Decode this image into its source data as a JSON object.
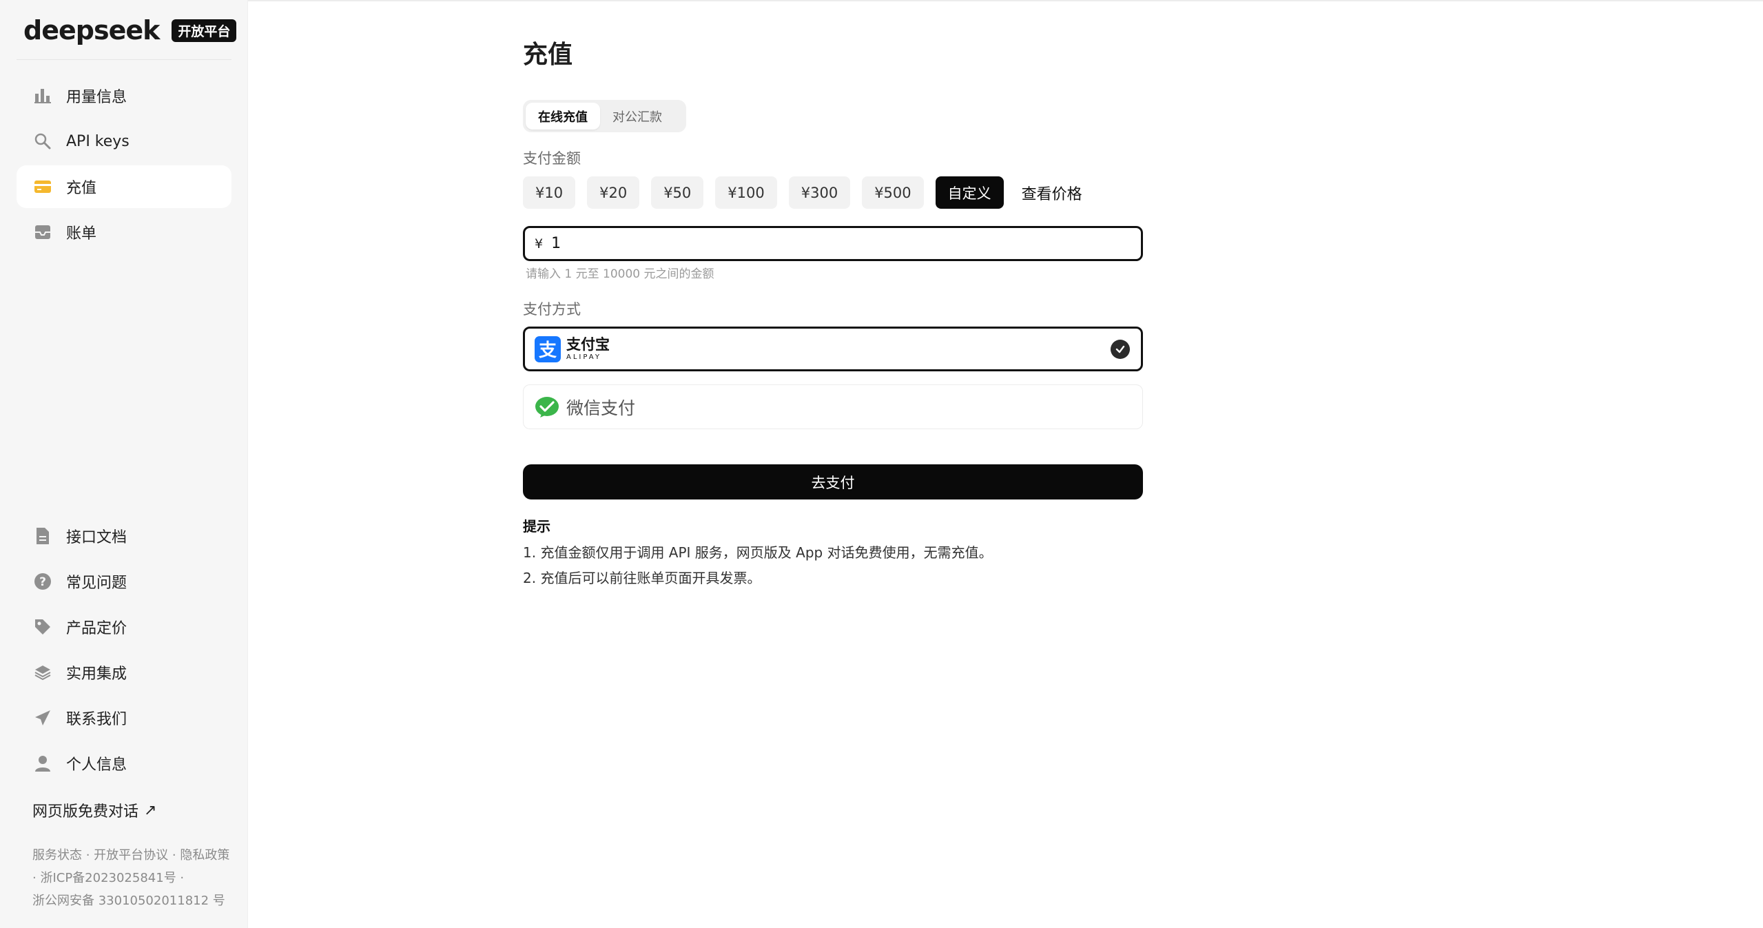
{
  "brand": {
    "logo_text": "deepseek",
    "badge": "开放平台"
  },
  "sidebar": {
    "top_items": [
      {
        "label": "用量信息",
        "icon": "bar-chart-icon"
      },
      {
        "label": "API keys",
        "icon": "search-key-icon"
      },
      {
        "label": "充值",
        "icon": "credit-card-icon",
        "active": true
      },
      {
        "label": "账单",
        "icon": "mail-tray-icon"
      }
    ],
    "bottom_items": [
      {
        "label": "接口文档",
        "icon": "document-icon"
      },
      {
        "label": "常见问题",
        "icon": "question-icon"
      },
      {
        "label": "产品定价",
        "icon": "tag-icon"
      },
      {
        "label": "实用集成",
        "icon": "layers-icon"
      },
      {
        "label": "联系我们",
        "icon": "send-icon"
      },
      {
        "label": "个人信息",
        "icon": "user-icon"
      }
    ],
    "web_chat": "网页版免费对话",
    "footer_line1": "服务状态 · 开放平台协议 · 隐私政策",
    "footer_line2": " · 浙ICP备2023025841号 · ",
    "footer_line3": "浙公网安备 33010502011812 号"
  },
  "main": {
    "title": "充值",
    "tabs": [
      {
        "label": "在线充值",
        "active": true
      },
      {
        "label": "对公汇款",
        "active": false
      }
    ],
    "amount_label": "支付金额",
    "amount_options": [
      "¥10",
      "¥20",
      "¥50",
      "¥100",
      "¥300",
      "¥500",
      "自定义"
    ],
    "selected_amount": "自定义",
    "price_link": "查看价格",
    "currency_symbol": "¥",
    "custom_amount_value": "1",
    "amount_hint": "请输入 1 元至 10000 元之间的金额",
    "method_label": "支付方式",
    "alipay": {
      "zh": "支付宝",
      "en": "ALIPAY",
      "selected": true
    },
    "wechat": {
      "label": "微信支付"
    },
    "pay_button": "去支付",
    "tips_title": "提示",
    "tips": [
      "1. 充值金额仅用于调用 API 服务，网页版及 App 对话免费使用，无需充值。",
      "2. 充值后可以前往账单页面开具发票。"
    ]
  },
  "colors": {
    "accent_dark": "#0a0a0a",
    "active_card_icon": "#f5b82e",
    "alipay_blue": "#1677ff",
    "wechat_green": "#3bb54a"
  }
}
